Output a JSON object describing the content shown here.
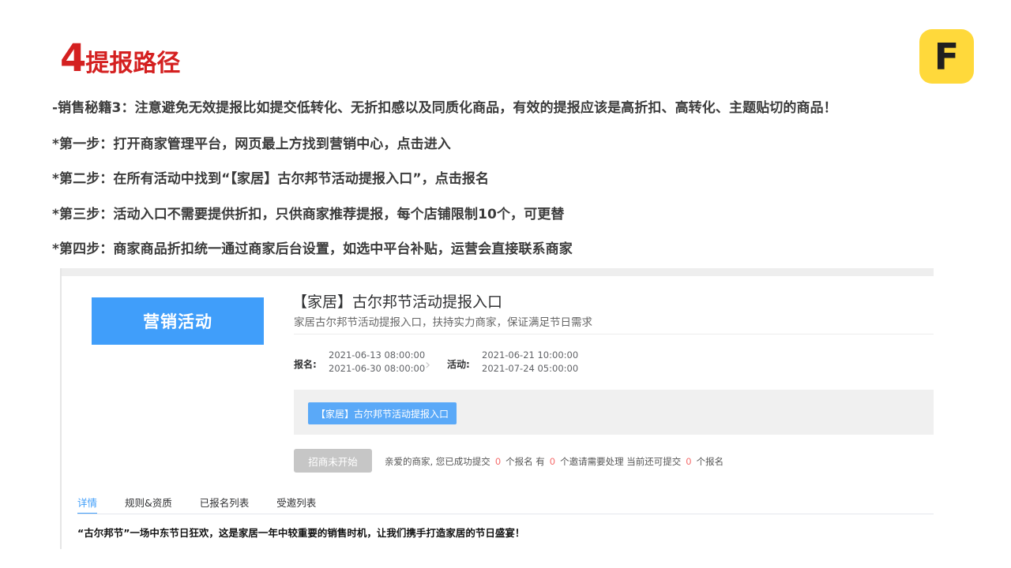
{
  "slide": {
    "title_num": "4",
    "title_text": "提报路径",
    "logo_letter": "F",
    "steps": [
      "-销售秘籍3：注意避免无效提报比如提交低转化、无折扣感以及同质化商品，有效的提报应该是高折扣、高转化、主题贴切的商品！",
      "*第一步：打开商家管理平台，网页最上方找到营销中心，点击进入",
      "*第二步：在所有活动中找到“【家居】古尔邦节活动提报入口”，点击报名",
      "*第三步：活动入口不需要提供折扣，只供商家推荐提报，每个店铺限制10个，可更替",
      "*第四步：商家商品折扣统一通过商家后台设置，如选中平台补贴，运营会直接联系商家"
    ]
  },
  "panel": {
    "banner": "营销活动",
    "title": "【家居】古尔邦节活动提报入口",
    "subtitle": "家居古尔邦节活动提报入口，扶持实力商家，保证满足节日需求",
    "signup_label": "报名:",
    "signup_start": "2021-06-13 08:00:00",
    "signup_end": "2021-06-30 08:00:00",
    "activity_label": "活动:",
    "activity_start": "2021-06-21 10:00:00",
    "activity_end": "2021-07-24 05:00:00",
    "entry_button": "【家居】古尔邦节活动提报入口",
    "disabled_button": "招商未开始",
    "stats": {
      "prefix": "亲爱的商家,  您已成功提交",
      "submitted": "0",
      "mid1": "个报名 有",
      "invites": "0",
      "mid2": "个邀请需要处理 当前还可提交",
      "remaining": "0",
      "suffix": "个报名"
    },
    "tabs": [
      "详情",
      "规则&资质",
      "已报名列表",
      "受邀列表"
    ],
    "detail_text": "“古尔邦节”一场中东节日狂欢，这是家居一年中较重要的销售时机，让我们携手打造家居的节日盛宴！"
  },
  "colors": {
    "title_red": "#d42020",
    "logo_yellow": "#ffd93b",
    "primary_blue": "#409efa",
    "stat_red": "#f56c6c"
  }
}
